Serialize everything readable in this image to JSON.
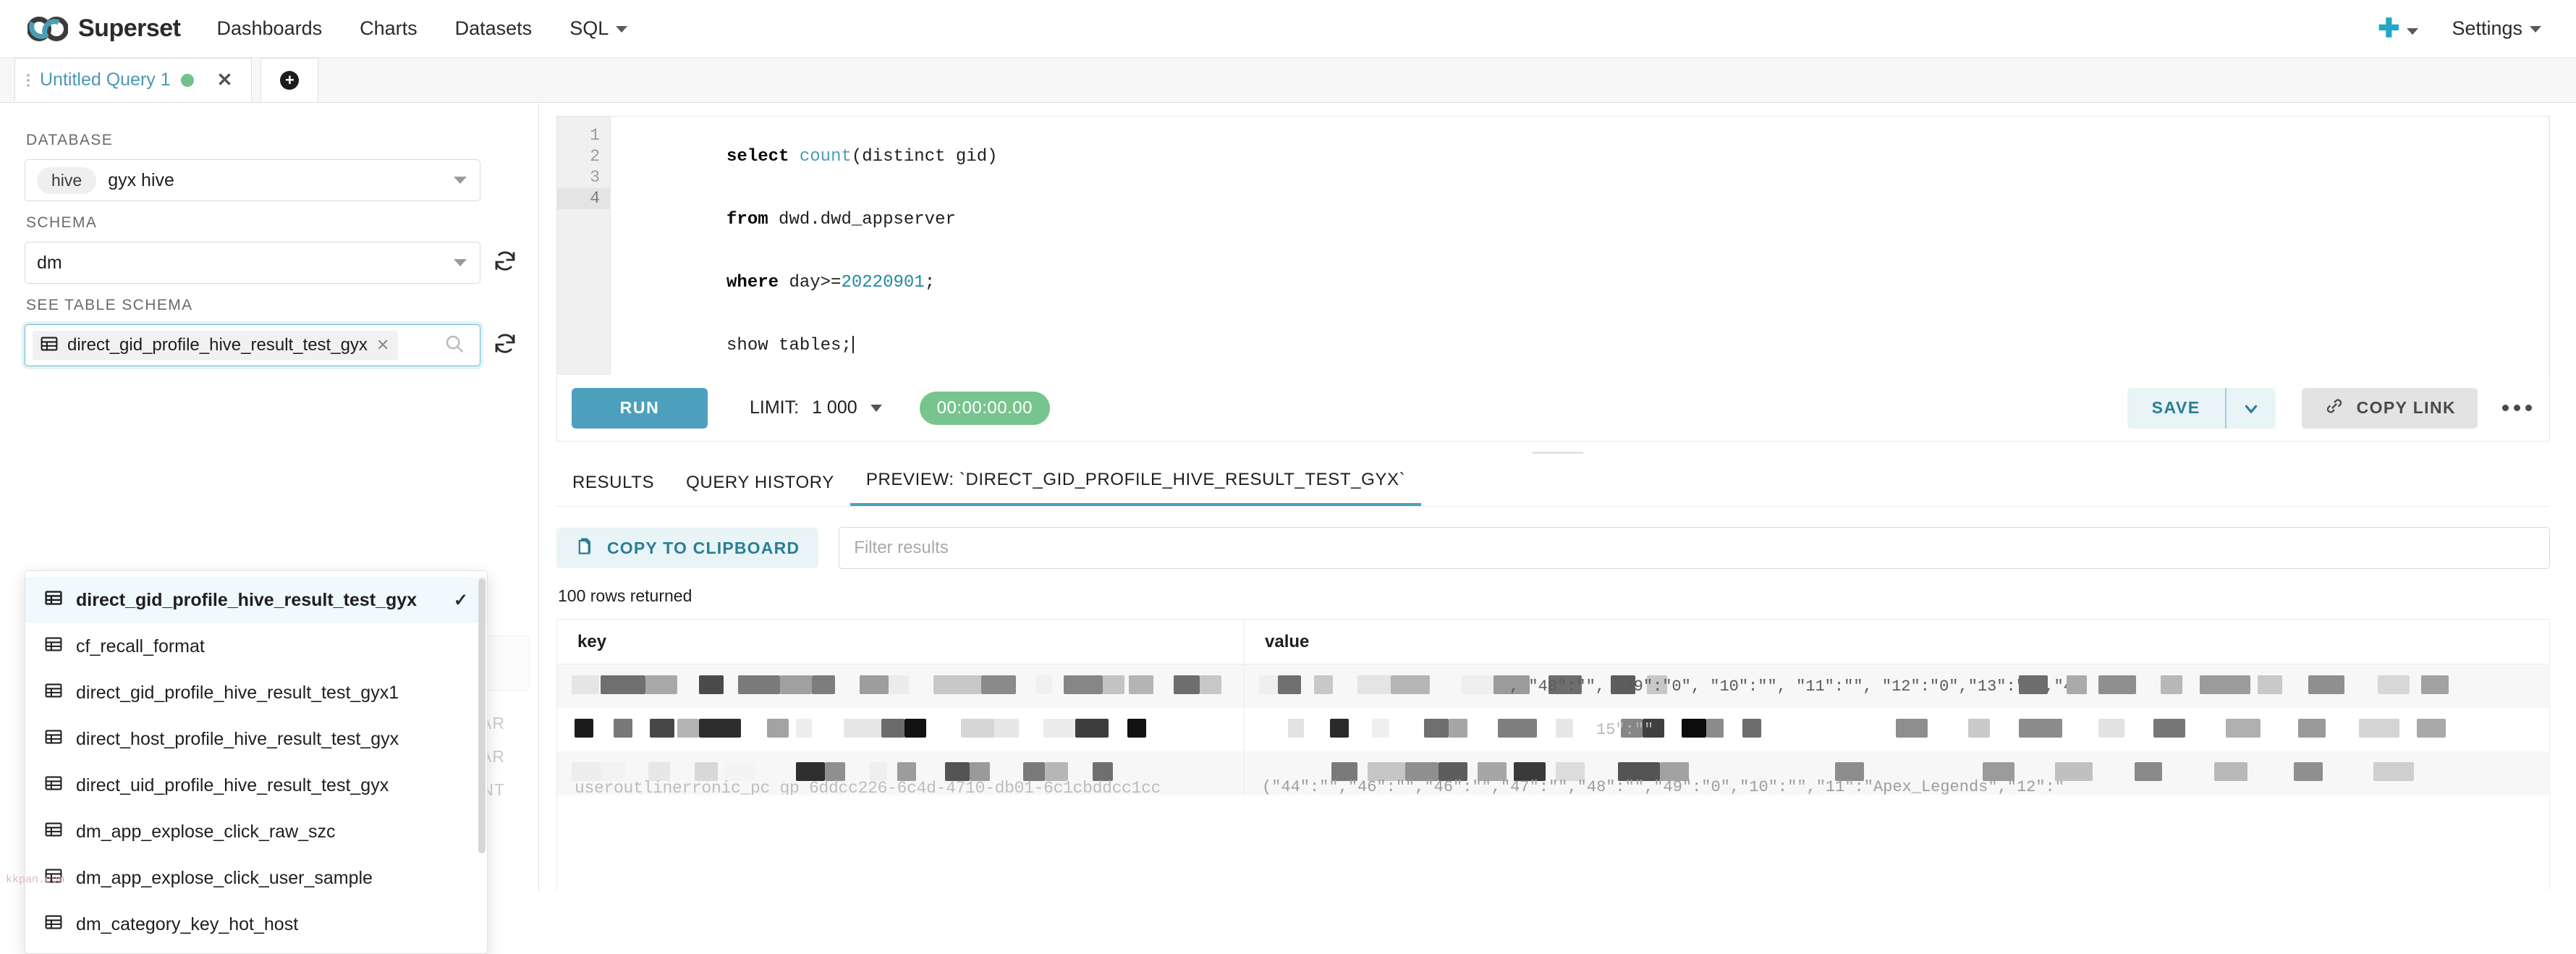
{
  "navbar": {
    "brand": "Superset",
    "links": [
      {
        "label": "Dashboards",
        "caret": false
      },
      {
        "label": "Charts",
        "caret": false
      },
      {
        "label": "Datasets",
        "caret": false
      },
      {
        "label": "SQL",
        "caret": true
      }
    ],
    "settings_label": "Settings"
  },
  "tabstrip": {
    "tab_label": "Untitled Query 1"
  },
  "left_panel": {
    "database_label": "DATABASE",
    "database_pill": "hive",
    "database_value": "gyx hive",
    "schema_label": "SCHEMA",
    "schema_value": "dm",
    "table_schema_label": "SEE TABLE SCHEMA",
    "selected_table": "direct_gid_profile_hive_result_test_gyx",
    "ghost_types": [
      "VARCHAR",
      "VARCHAR",
      "BIGINT"
    ],
    "dropdown_items": [
      {
        "label": "direct_gid_profile_hive_result_test_gyx",
        "selected": true
      },
      {
        "label": "cf_recall_format",
        "selected": false
      },
      {
        "label": "direct_gid_profile_hive_result_test_gyx1",
        "selected": false
      },
      {
        "label": "direct_host_profile_hive_result_test_gyx",
        "selected": false
      },
      {
        "label": "direct_uid_profile_hive_result_test_gyx",
        "selected": false
      },
      {
        "label": "dm_app_explose_click_raw_szc",
        "selected": false
      },
      {
        "label": "dm_app_explose_click_user_sample",
        "selected": false
      },
      {
        "label": "dm_category_key_hot_host",
        "selected": false
      }
    ]
  },
  "editor": {
    "line_numbers": [
      "1",
      "2",
      "3",
      "4"
    ],
    "lines": [
      {
        "segments": [
          {
            "t": "select",
            "c": "k"
          },
          {
            "t": " ",
            "c": ""
          },
          {
            "t": "count",
            "c": "fn"
          },
          {
            "t": "(distinct gid)",
            "c": ""
          }
        ]
      },
      {
        "segments": [
          {
            "t": "from",
            "c": "k"
          },
          {
            "t": " dwd.dwd_appserver",
            "c": ""
          }
        ]
      },
      {
        "segments": [
          {
            "t": "where",
            "c": "k"
          },
          {
            "t": " day>=",
            "c": ""
          },
          {
            "t": "20220901",
            "c": "num"
          },
          {
            "t": ";",
            "c": ""
          }
        ]
      },
      {
        "segments": [
          {
            "t": "show tables;",
            "c": ""
          }
        ]
      }
    ]
  },
  "runbar": {
    "run_label": "RUN",
    "limit_label": "LIMIT:",
    "limit_value": "1 000",
    "timer": "00:00:00.00",
    "save_label": "SAVE",
    "copy_link_label": "COPY LINK"
  },
  "results": {
    "tabs": [
      {
        "label": "RESULTS",
        "active": false
      },
      {
        "label": "QUERY HISTORY",
        "active": false
      },
      {
        "label": "PREVIEW: `DIRECT_GID_PROFILE_HIVE_RESULT_TEST_GYX`",
        "active": true
      }
    ],
    "copy_clipboard_label": "COPY TO CLIPBOARD",
    "filter_placeholder": "Filter results",
    "rows_returned": "100 rows returned",
    "columns": [
      "key",
      "value"
    ],
    "rows": [
      {
        "key_redacted": true,
        "value_partial": ", \"48\":\"\", \"49\":\"0\", \"10\":\"\", \"11\":\"\", \"12\":\"0\",\"13\":\"0\",\"4"
      },
      {
        "key_redacted": true,
        "value_partial": "15\":\"\""
      },
      {
        "key_redacted": true,
        "value_partial": "(\"44\":\"\",\"46\":\"\",\"46\":\"\",\"47\":\"\",\"48\":\"\",\"49\":\"0\",\"10\":\"\",\"11\":\"Apex_Legends\",\"12\":\""
      }
    ],
    "last_row_ghost": "useroutlinerronic_pc gp 6ddcc226-6c4d-4710-db01-6c1cbddcc1cc"
  },
  "watermark": "kkpan.com",
  "colors": {
    "accent": "#20a7c9",
    "run_button": "#4da0bd",
    "timer_green": "#78c48e",
    "tab_link": "#4b98b3"
  }
}
